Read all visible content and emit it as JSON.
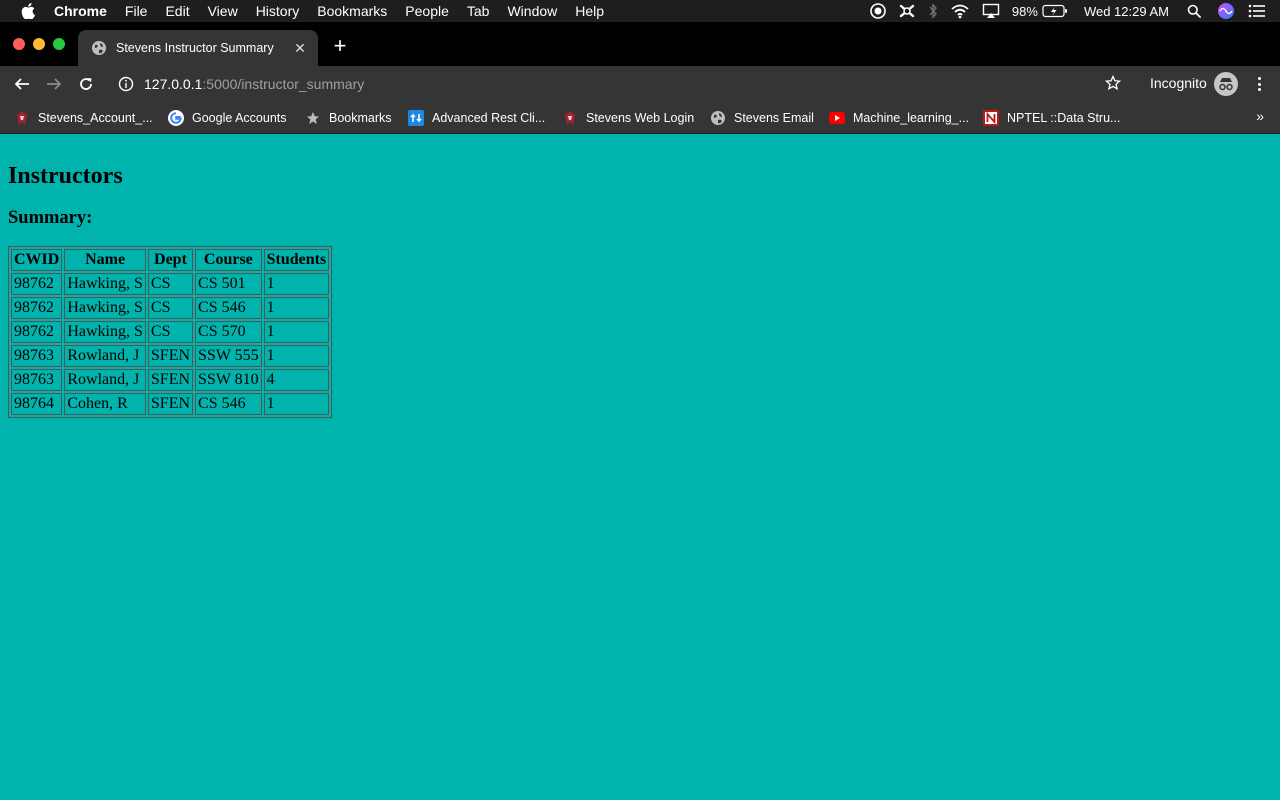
{
  "menubar": {
    "app": "Chrome",
    "items": [
      "File",
      "Edit",
      "View",
      "History",
      "Bookmarks",
      "People",
      "Tab",
      "Window",
      "Help"
    ],
    "battery": "98%",
    "clock": "Wed 12:29 AM"
  },
  "tab": {
    "title": "Stevens Instructor Summary"
  },
  "omnibox": {
    "host": "127.0.0.1",
    "path": ":5000/instructor_summary"
  },
  "toolbar": {
    "profile_label": "Incognito"
  },
  "bookmarks": [
    {
      "label": "Stevens_Account_...",
      "icon": "stevens-icon"
    },
    {
      "label": "Google Accounts",
      "icon": "google-icon"
    },
    {
      "label": "Bookmarks",
      "icon": "star-icon"
    },
    {
      "label": "Advanced Rest Cli...",
      "icon": "arc-icon"
    },
    {
      "label": "Stevens Web Login",
      "icon": "stevens-icon"
    },
    {
      "label": "Stevens Email",
      "icon": "globe-icon"
    },
    {
      "label": "Machine_learning_...",
      "icon": "youtube-icon"
    },
    {
      "label": "NPTEL ::Data Stru...",
      "icon": "nptel-icon"
    }
  ],
  "page": {
    "heading": "Instructors",
    "subheading": "Summary:",
    "table": {
      "headers": [
        "CWID",
        "Name",
        "Dept",
        "Course",
        "Students"
      ],
      "rows": [
        [
          "98762",
          "Hawking, S",
          "CS",
          "CS 501",
          "1"
        ],
        [
          "98762",
          "Hawking, S",
          "CS",
          "CS 546",
          "1"
        ],
        [
          "98762",
          "Hawking, S",
          "CS",
          "CS 570",
          "1"
        ],
        [
          "98763",
          "Rowland, J",
          "SFEN",
          "SSW 555",
          "1"
        ],
        [
          "98763",
          "Rowland, J",
          "SFEN",
          "SSW 810",
          "4"
        ],
        [
          "98764",
          "Cohen, R",
          "SFEN",
          "CS 546",
          "1"
        ]
      ]
    }
  },
  "colors": {
    "page_background": "#00b3ad"
  }
}
